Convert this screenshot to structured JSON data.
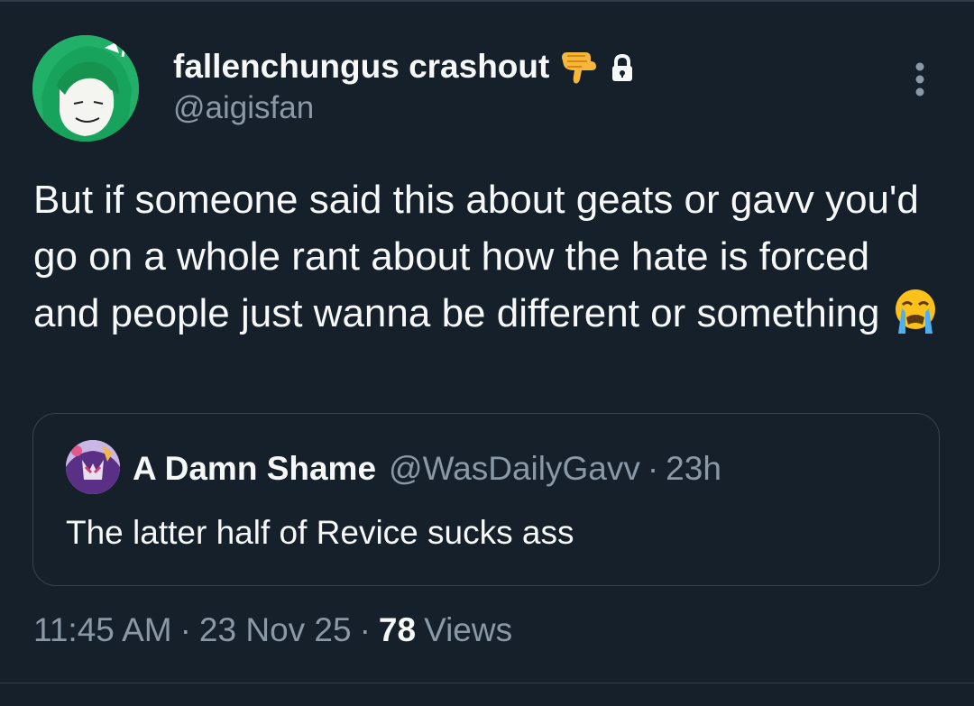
{
  "author": {
    "display_name": "fallenchungus crashout",
    "name_emoji": "pointing-down-hand-emoji",
    "protected_icon": "lock-icon",
    "handle": "@aigisfan",
    "avatar_icon": "green-haired-anime-avatar"
  },
  "menu": {
    "icon": "more-vertical-icon"
  },
  "tweet": {
    "text": "But if someone said this about geats or gavv you'd go on a whole rant about how the hate is forced and people just wanna be different or something",
    "trailing_emoji": "loudly-crying-face-emoji"
  },
  "quoted_tweet": {
    "avatar_icon": "kamen-rider-avatar",
    "display_name": "A Damn Shame",
    "handle": "@WasDailyGavv",
    "separator": "·",
    "time": "23h",
    "text": "The latter half of Revice sucks ass"
  },
  "meta": {
    "time": "11:45 AM",
    "sep1": "·",
    "date": "23 Nov 25",
    "sep2": "·",
    "views_count": "78",
    "views_label": "Views"
  },
  "colors": {
    "background": "#15202b",
    "primary_text": "#f7f9f9",
    "secondary_text": "#8b98a5",
    "border": "#38444d"
  }
}
